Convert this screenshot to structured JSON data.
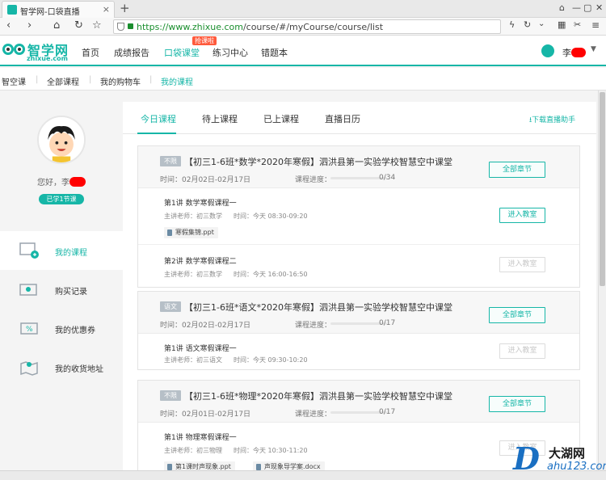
{
  "browser": {
    "tab_title": "智学网-口袋直播",
    "url_host": "https://www.zhixue.com",
    "url_path": "/course/#/myCourse/course/list"
  },
  "site": {
    "logo_text": "智学网",
    "logo_sub": "zhixue.com",
    "nav": [
      "首页",
      "成绩报告",
      "口袋课堂",
      "练习中心",
      "错题本"
    ],
    "hot_badge": "抢课啦",
    "user_initial": "李"
  },
  "subnav": [
    "智空课",
    "全部课程",
    "我的购物车",
    "我的课程"
  ],
  "sidebar": {
    "greeting": "您好，李",
    "learned_badge": "已学1节课",
    "items": [
      "我的课程",
      "购买记录",
      "我的优惠券",
      "我的收货地址"
    ]
  },
  "tabs": [
    "今日课程",
    "待上课程",
    "已上课程",
    "直播日历"
  ],
  "download_link": "下载直播助手",
  "courses": [
    {
      "tag": "不限",
      "title": "【初三1-6班*数学*2020年寒假】泗洪县第一实验学校智慧空中课堂",
      "time": "时间：02月02日-02月17日",
      "progress_label": "课程进度：",
      "progress": "0/34",
      "chapters_label": "全部章节",
      "lessons": [
        {
          "title": "第1讲  数学寒假课程一",
          "teacher": "主讲老师：初三数学",
          "time": "时间：今天 08:30-09:20",
          "button": "进入教室",
          "files": [
            "寒假集锦.ppt"
          ]
        },
        {
          "title": "第2讲  数学寒假课程二",
          "teacher": "主讲老师：初三数学",
          "time": "时间：今天 16:00-16:50",
          "button": "进入教室",
          "files": []
        }
      ]
    },
    {
      "tag": "语文",
      "title": "【初三1-6班*语文*2020年寒假】泗洪县第一实验学校智慧空中课堂",
      "time": "时间：02月02日-02月17日",
      "progress_label": "课程进度：",
      "progress": "0/17",
      "chapters_label": "全部章节",
      "lessons": [
        {
          "title": "第1讲  语文寒假课程一",
          "teacher": "主讲老师：初三语文",
          "time": "时间：今天 09:30-10:20",
          "button": "进入教室",
          "files": []
        }
      ]
    },
    {
      "tag": "不限",
      "title": "【初三1-6班*物理*2020年寒假】泗洪县第一实验学校智慧空中课堂",
      "time": "时间：02月01日-02月17日",
      "progress_label": "课程进度：",
      "progress": "0/17",
      "chapters_label": "全部章节",
      "lessons": [
        {
          "title": "第1讲  物理寒假课程一",
          "teacher": "主讲老师：初三物理",
          "time": "时间：今天 10:30-11:20",
          "button": "进入教室",
          "files": [
            "第1课时声现象.ppt",
            "声现象导学案.docx"
          ]
        }
      ]
    }
  ],
  "watermark": {
    "mark": "D",
    "name": "大湖网",
    "url": "ahu123.com"
  },
  "colors": {
    "accent": "#16b6a7",
    "hot": "#ff5a3c"
  }
}
